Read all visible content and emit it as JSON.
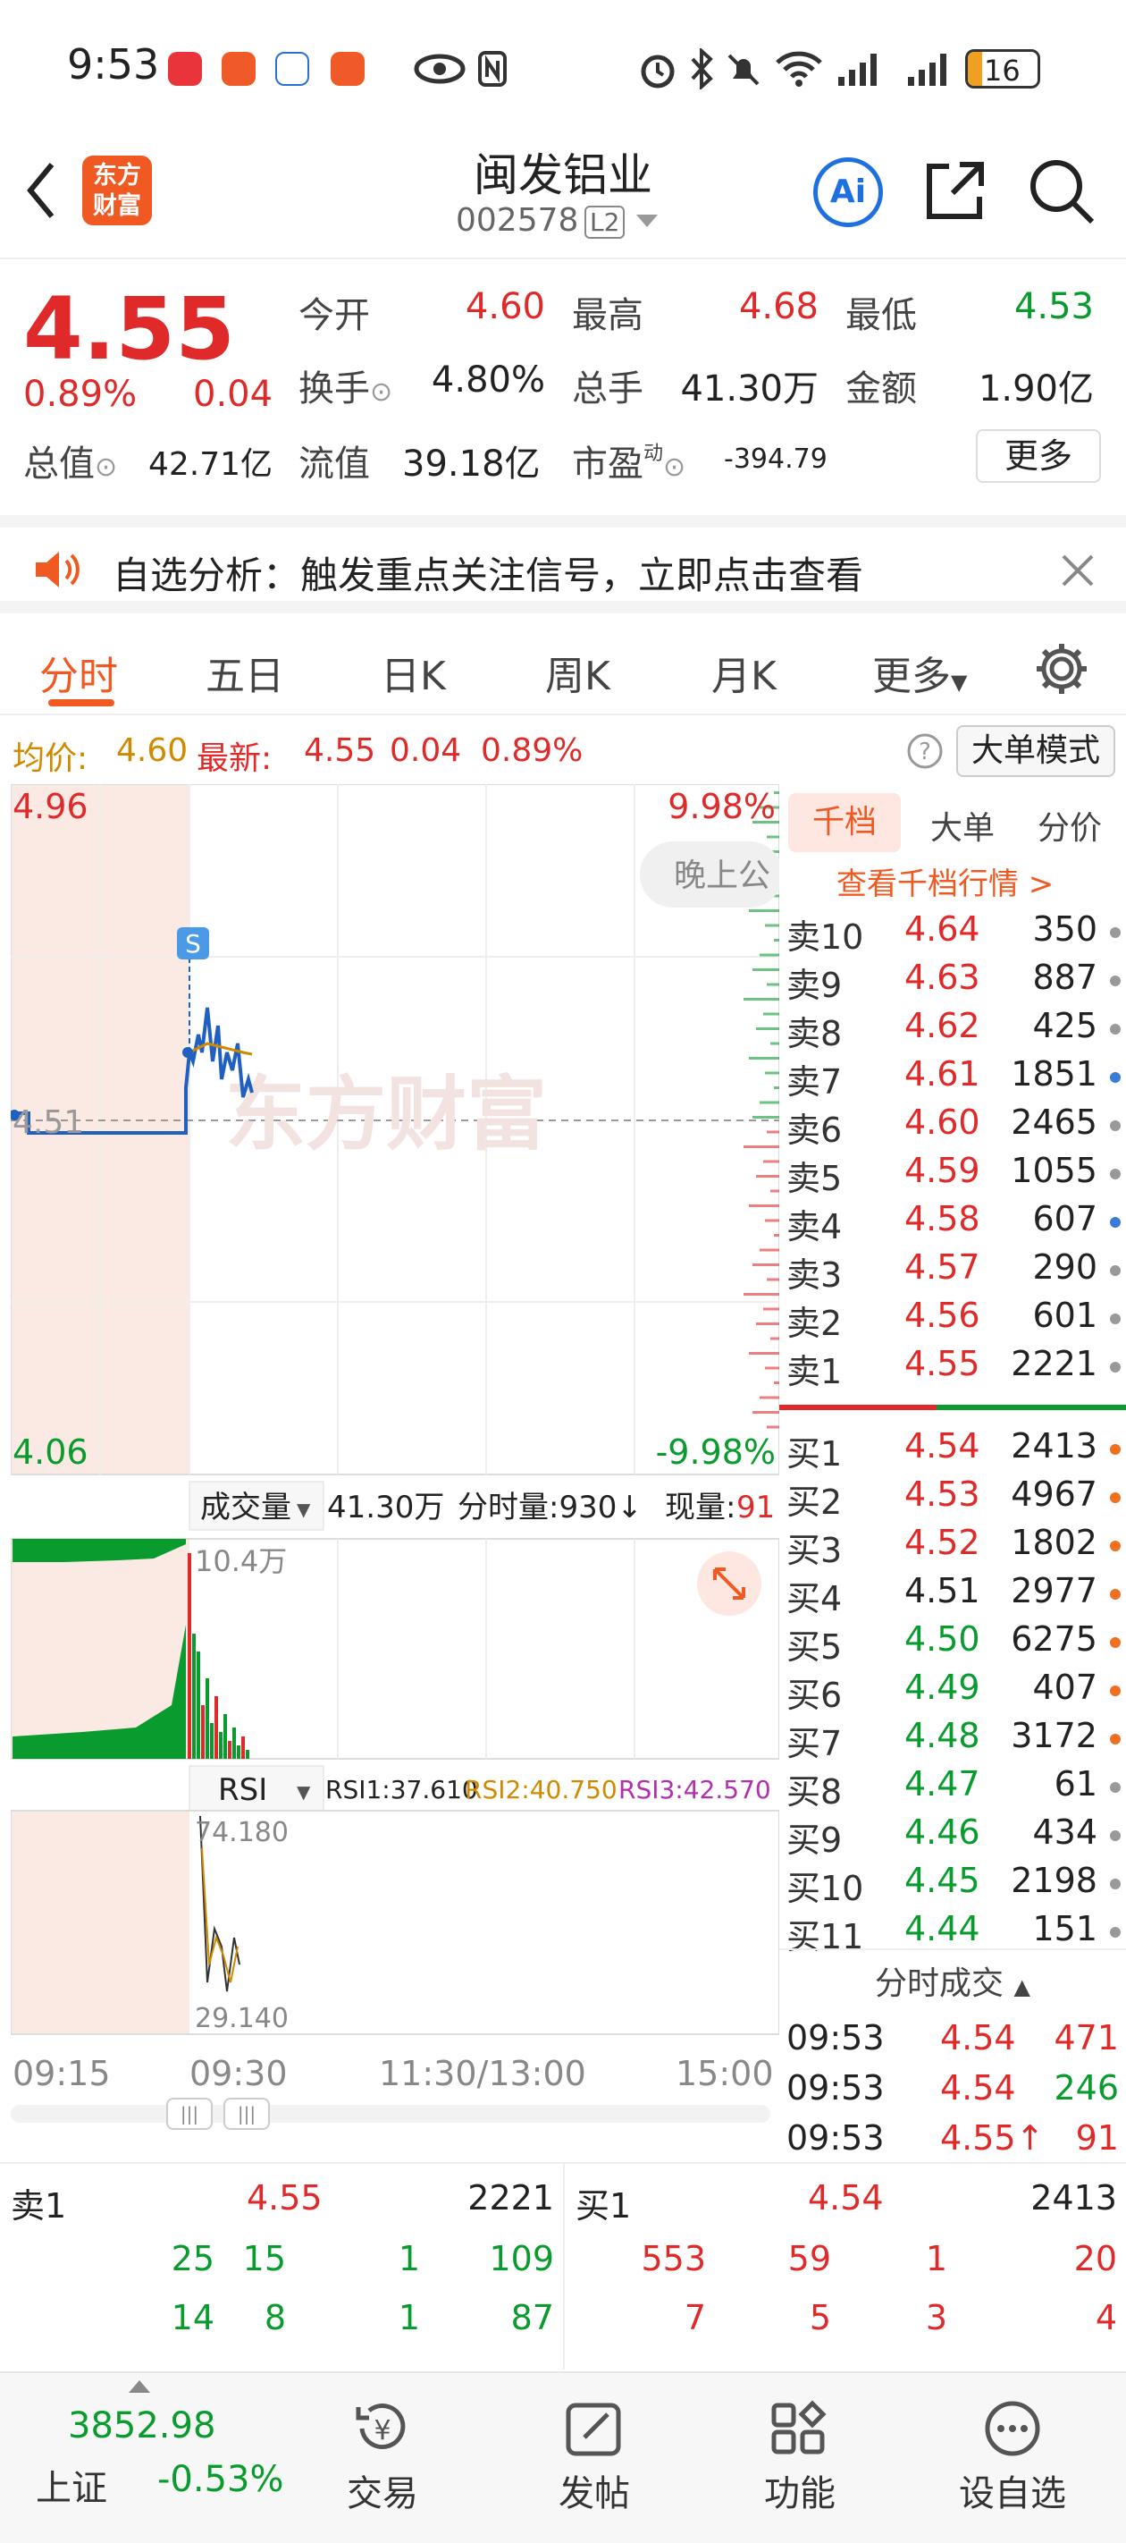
{
  "status_bar": {
    "time": "9:53",
    "battery": "16"
  },
  "header": {
    "title": "闽发铝业",
    "code": "002578",
    "level": "L2",
    "ai_label": "Ai",
    "logo_text": [
      "东方",
      "财富"
    ]
  },
  "quote": {
    "price": "4.55",
    "change_pct": "0.89%",
    "change": "0.04",
    "open_label": "今开",
    "open": "4.60",
    "high_label": "最高",
    "high": "4.68",
    "low_label": "最低",
    "low": "4.53",
    "turnover_label": "换手",
    "turnover": "4.80%",
    "volume_label": "总手",
    "volume": "41.30万",
    "amount_label": "金额",
    "amount": "1.90亿",
    "mktcap_label": "总值",
    "mktcap": "42.71亿",
    "float_label": "流值",
    "float": "39.18亿",
    "pe_label": "市盈",
    "pe_sup": "动",
    "pe": "-394.79",
    "more": "更多"
  },
  "notice": {
    "text": "自选分析：触发重点关注信号，立即点击查看"
  },
  "tabs": [
    "分时",
    "五日",
    "日K",
    "周K",
    "月K",
    "更多"
  ],
  "avg_bar": {
    "avg_label": "均价:",
    "avg": "4.60",
    "latest_label": "最新:",
    "latest": "4.55",
    "change": "0.04",
    "pct": "0.89%",
    "mode_button": "大单模式"
  },
  "chart": {
    "price_high": "4.96",
    "price_low": "4.06",
    "pct_high": "9.98%",
    "pct_low": "-9.98%",
    "mid_price": "4.51",
    "watermark": "东方财富",
    "overlay_text": "晚上公",
    "marker": "S",
    "volume_selector": "成交量",
    "volume_total": "41.30万",
    "minute_vol": "分时量:930↓",
    "cur_vol_label": "现量:",
    "cur_vol": "91",
    "vol_max": "10.4万",
    "rsi_selector": "RSI",
    "rsi1": "RSI1:37.610",
    "rsi2": "RSI2:40.750",
    "rsi3": "RSI3:42.570",
    "rsi_high": "74.180",
    "rsi_low": "29.140",
    "time_labels": [
      "09:15",
      "09:30",
      "11:30/13:00",
      "15:00"
    ]
  },
  "orderbook": {
    "tabs": [
      "千档",
      "大单",
      "分价"
    ],
    "link": "查看千档行情 >",
    "asks": [
      {
        "label": "卖10",
        "price": "4.64",
        "vol": "350",
        "dot": "#999"
      },
      {
        "label": "卖9",
        "price": "4.63",
        "vol": "887",
        "dot": "#999"
      },
      {
        "label": "卖8",
        "price": "4.62",
        "vol": "425",
        "dot": "#999"
      },
      {
        "label": "卖7",
        "price": "4.61",
        "vol": "1851",
        "dot": "#3a7bd5"
      },
      {
        "label": "卖6",
        "price": "4.60",
        "vol": "2465",
        "dot": "#999"
      },
      {
        "label": "卖5",
        "price": "4.59",
        "vol": "1055",
        "dot": "#999"
      },
      {
        "label": "卖4",
        "price": "4.58",
        "vol": "607",
        "dot": "#3a7bd5"
      },
      {
        "label": "卖3",
        "price": "4.57",
        "vol": "290",
        "dot": "#999"
      },
      {
        "label": "卖2",
        "price": "4.56",
        "vol": "601",
        "dot": "#999"
      },
      {
        "label": "卖1",
        "price": "4.55",
        "vol": "2221",
        "dot": "#999"
      }
    ],
    "bids": [
      {
        "label": "买1",
        "price": "4.54",
        "vol": "2413",
        "dot": "#f07020"
      },
      {
        "label": "买2",
        "price": "4.53",
        "vol": "4967",
        "dot": "#f07020"
      },
      {
        "label": "买3",
        "price": "4.52",
        "vol": "1802",
        "dot": "#f07020"
      },
      {
        "label": "买4",
        "price": "4.51",
        "vol": "2977",
        "dot": "#f07020"
      },
      {
        "label": "买5",
        "price": "4.50",
        "vol": "6275",
        "dot": "#f07020"
      },
      {
        "label": "买6",
        "price": "4.49",
        "vol": "407",
        "dot": "#f07020"
      },
      {
        "label": "买7",
        "price": "4.48",
        "vol": "3172",
        "dot": "#f07020"
      },
      {
        "label": "买8",
        "price": "4.47",
        "vol": "61",
        "dot": "#999"
      },
      {
        "label": "买9",
        "price": "4.46",
        "vol": "434",
        "dot": "#999"
      },
      {
        "label": "买10",
        "price": "4.45",
        "vol": "2198",
        "dot": "#999"
      },
      {
        "label": "买11",
        "price": "4.44",
        "vol": "151",
        "dot": "#999"
      }
    ],
    "trades_title": "分时成交",
    "trades": [
      {
        "time": "09:53",
        "price": "4.54",
        "vol": "471"
      },
      {
        "time": "09:53",
        "price": "4.54",
        "vol": "246"
      },
      {
        "time": "09:53",
        "price": "4.55↑",
        "vol": "91"
      }
    ]
  },
  "levels": {
    "sell_label": "卖1",
    "sell_price": "4.55",
    "sell_vol": "2221",
    "buy_label": "买1",
    "buy_price": "4.54",
    "buy_vol": "2413",
    "sell_row1": [
      "25",
      "15",
      "1",
      "109"
    ],
    "sell_row2": [
      "14",
      "8",
      "1",
      "87"
    ],
    "buy_row1": [
      "553",
      "59",
      "1",
      "20"
    ],
    "buy_row2": [
      "7",
      "5",
      "3",
      "4"
    ]
  },
  "bottom_nav": {
    "index_value": "3852.98",
    "index_name": "上证",
    "index_change": "-0.53%",
    "items": [
      "交易",
      "发帖",
      "功能",
      "设自选"
    ]
  }
}
